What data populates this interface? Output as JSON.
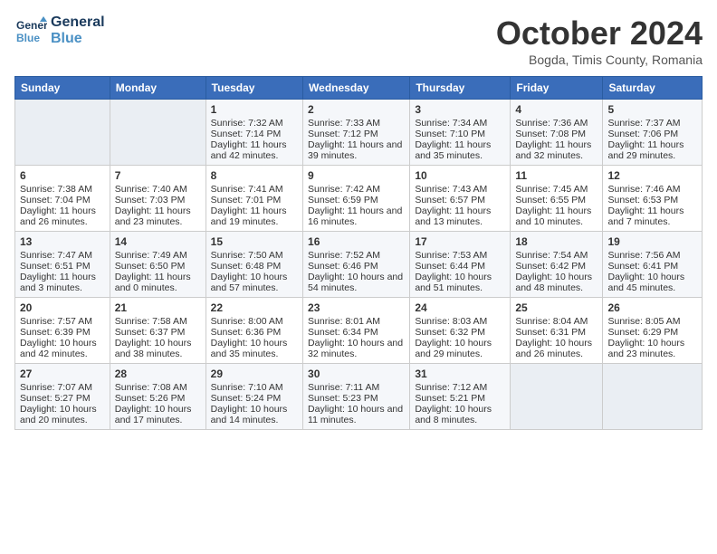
{
  "header": {
    "logo_line1": "General",
    "logo_line2": "Blue",
    "month_title": "October 2024",
    "subtitle": "Bogda, Timis County, Romania"
  },
  "days_of_week": [
    "Sunday",
    "Monday",
    "Tuesday",
    "Wednesday",
    "Thursday",
    "Friday",
    "Saturday"
  ],
  "weeks": [
    [
      {
        "day": "",
        "sunrise": "",
        "sunset": "",
        "daylight": ""
      },
      {
        "day": "",
        "sunrise": "",
        "sunset": "",
        "daylight": ""
      },
      {
        "day": "1",
        "sunrise": "Sunrise: 7:32 AM",
        "sunset": "Sunset: 7:14 PM",
        "daylight": "Daylight: 11 hours and 42 minutes."
      },
      {
        "day": "2",
        "sunrise": "Sunrise: 7:33 AM",
        "sunset": "Sunset: 7:12 PM",
        "daylight": "Daylight: 11 hours and 39 minutes."
      },
      {
        "day": "3",
        "sunrise": "Sunrise: 7:34 AM",
        "sunset": "Sunset: 7:10 PM",
        "daylight": "Daylight: 11 hours and 35 minutes."
      },
      {
        "day": "4",
        "sunrise": "Sunrise: 7:36 AM",
        "sunset": "Sunset: 7:08 PM",
        "daylight": "Daylight: 11 hours and 32 minutes."
      },
      {
        "day": "5",
        "sunrise": "Sunrise: 7:37 AM",
        "sunset": "Sunset: 7:06 PM",
        "daylight": "Daylight: 11 hours and 29 minutes."
      }
    ],
    [
      {
        "day": "6",
        "sunrise": "Sunrise: 7:38 AM",
        "sunset": "Sunset: 7:04 PM",
        "daylight": "Daylight: 11 hours and 26 minutes."
      },
      {
        "day": "7",
        "sunrise": "Sunrise: 7:40 AM",
        "sunset": "Sunset: 7:03 PM",
        "daylight": "Daylight: 11 hours and 23 minutes."
      },
      {
        "day": "8",
        "sunrise": "Sunrise: 7:41 AM",
        "sunset": "Sunset: 7:01 PM",
        "daylight": "Daylight: 11 hours and 19 minutes."
      },
      {
        "day": "9",
        "sunrise": "Sunrise: 7:42 AM",
        "sunset": "Sunset: 6:59 PM",
        "daylight": "Daylight: 11 hours and 16 minutes."
      },
      {
        "day": "10",
        "sunrise": "Sunrise: 7:43 AM",
        "sunset": "Sunset: 6:57 PM",
        "daylight": "Daylight: 11 hours and 13 minutes."
      },
      {
        "day": "11",
        "sunrise": "Sunrise: 7:45 AM",
        "sunset": "Sunset: 6:55 PM",
        "daylight": "Daylight: 11 hours and 10 minutes."
      },
      {
        "day": "12",
        "sunrise": "Sunrise: 7:46 AM",
        "sunset": "Sunset: 6:53 PM",
        "daylight": "Daylight: 11 hours and 7 minutes."
      }
    ],
    [
      {
        "day": "13",
        "sunrise": "Sunrise: 7:47 AM",
        "sunset": "Sunset: 6:51 PM",
        "daylight": "Daylight: 11 hours and 3 minutes."
      },
      {
        "day": "14",
        "sunrise": "Sunrise: 7:49 AM",
        "sunset": "Sunset: 6:50 PM",
        "daylight": "Daylight: 11 hours and 0 minutes."
      },
      {
        "day": "15",
        "sunrise": "Sunrise: 7:50 AM",
        "sunset": "Sunset: 6:48 PM",
        "daylight": "Daylight: 10 hours and 57 minutes."
      },
      {
        "day": "16",
        "sunrise": "Sunrise: 7:52 AM",
        "sunset": "Sunset: 6:46 PM",
        "daylight": "Daylight: 10 hours and 54 minutes."
      },
      {
        "day": "17",
        "sunrise": "Sunrise: 7:53 AM",
        "sunset": "Sunset: 6:44 PM",
        "daylight": "Daylight: 10 hours and 51 minutes."
      },
      {
        "day": "18",
        "sunrise": "Sunrise: 7:54 AM",
        "sunset": "Sunset: 6:42 PM",
        "daylight": "Daylight: 10 hours and 48 minutes."
      },
      {
        "day": "19",
        "sunrise": "Sunrise: 7:56 AM",
        "sunset": "Sunset: 6:41 PM",
        "daylight": "Daylight: 10 hours and 45 minutes."
      }
    ],
    [
      {
        "day": "20",
        "sunrise": "Sunrise: 7:57 AM",
        "sunset": "Sunset: 6:39 PM",
        "daylight": "Daylight: 10 hours and 42 minutes."
      },
      {
        "day": "21",
        "sunrise": "Sunrise: 7:58 AM",
        "sunset": "Sunset: 6:37 PM",
        "daylight": "Daylight: 10 hours and 38 minutes."
      },
      {
        "day": "22",
        "sunrise": "Sunrise: 8:00 AM",
        "sunset": "Sunset: 6:36 PM",
        "daylight": "Daylight: 10 hours and 35 minutes."
      },
      {
        "day": "23",
        "sunrise": "Sunrise: 8:01 AM",
        "sunset": "Sunset: 6:34 PM",
        "daylight": "Daylight: 10 hours and 32 minutes."
      },
      {
        "day": "24",
        "sunrise": "Sunrise: 8:03 AM",
        "sunset": "Sunset: 6:32 PM",
        "daylight": "Daylight: 10 hours and 29 minutes."
      },
      {
        "day": "25",
        "sunrise": "Sunrise: 8:04 AM",
        "sunset": "Sunset: 6:31 PM",
        "daylight": "Daylight: 10 hours and 26 minutes."
      },
      {
        "day": "26",
        "sunrise": "Sunrise: 8:05 AM",
        "sunset": "Sunset: 6:29 PM",
        "daylight": "Daylight: 10 hours and 23 minutes."
      }
    ],
    [
      {
        "day": "27",
        "sunrise": "Sunrise: 7:07 AM",
        "sunset": "Sunset: 5:27 PM",
        "daylight": "Daylight: 10 hours and 20 minutes."
      },
      {
        "day": "28",
        "sunrise": "Sunrise: 7:08 AM",
        "sunset": "Sunset: 5:26 PM",
        "daylight": "Daylight: 10 hours and 17 minutes."
      },
      {
        "day": "29",
        "sunrise": "Sunrise: 7:10 AM",
        "sunset": "Sunset: 5:24 PM",
        "daylight": "Daylight: 10 hours and 14 minutes."
      },
      {
        "day": "30",
        "sunrise": "Sunrise: 7:11 AM",
        "sunset": "Sunset: 5:23 PM",
        "daylight": "Daylight: 10 hours and 11 minutes."
      },
      {
        "day": "31",
        "sunrise": "Sunrise: 7:12 AM",
        "sunset": "Sunset: 5:21 PM",
        "daylight": "Daylight: 10 hours and 8 minutes."
      },
      {
        "day": "",
        "sunrise": "",
        "sunset": "",
        "daylight": ""
      },
      {
        "day": "",
        "sunrise": "",
        "sunset": "",
        "daylight": ""
      }
    ]
  ]
}
